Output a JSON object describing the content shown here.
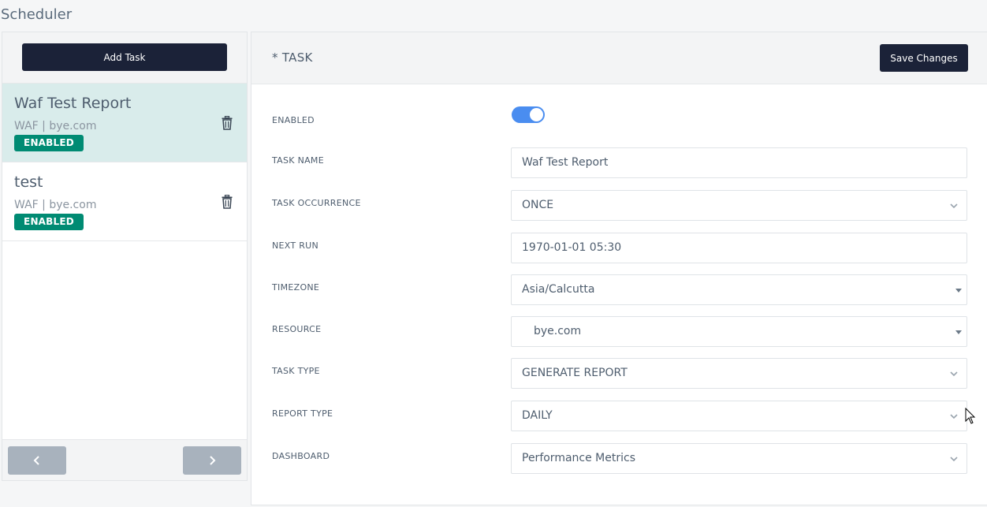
{
  "page": {
    "title": "Scheduler"
  },
  "left": {
    "add_task_label": "Add Task",
    "tasks": [
      {
        "name": "Waf Test Report",
        "meta": "WAF | bye.com",
        "status": "ENABLED",
        "active": true
      },
      {
        "name": "test",
        "meta": "WAF | bye.com",
        "status": "ENABLED",
        "active": false
      }
    ],
    "pager": {
      "prev_icon": "chevron-left-icon",
      "next_icon": "chevron-right-icon"
    }
  },
  "form": {
    "title": "* TASK",
    "save_label": "Save Changes",
    "enabled": {
      "label": "ENABLED",
      "value": true
    },
    "task_name": {
      "label": "TASK NAME",
      "value": "Waf Test Report"
    },
    "task_occurrence": {
      "label": "TASK OCCURRENCE",
      "value": "ONCE"
    },
    "next_run": {
      "label": "NEXT RUN",
      "value": "1970-01-01 05:30"
    },
    "timezone": {
      "label": "TIMEZONE",
      "value": "Asia/Calcutta"
    },
    "resource": {
      "label": "RESOURCE",
      "value": "bye.com"
    },
    "task_type": {
      "label": "TASK TYPE",
      "value": "GENERATE REPORT"
    },
    "report_type": {
      "label": "REPORT TYPE",
      "value": "DAILY"
    },
    "dashboard": {
      "label": "DASHBOARD",
      "value": "Performance Metrics"
    }
  },
  "colors": {
    "primary_dark": "#1b2238",
    "badge_green": "#008b73",
    "toggle_blue": "#4a8df0",
    "active_row": "#d9eceb"
  }
}
